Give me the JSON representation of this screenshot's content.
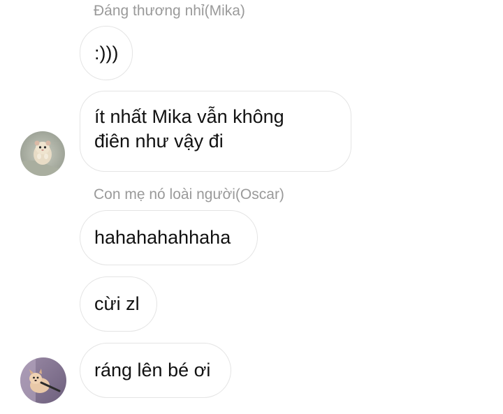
{
  "chat": {
    "groups": [
      {
        "sender": "Đáng thương nhỉ(Mika)",
        "messages": [
          {
            "lines": [
              ":)))"
            ]
          },
          {
            "lines": [
              "ít nhất Mika vẫn không",
              "điên như vậy đi"
            ]
          }
        ],
        "avatar": "hamster-avatar"
      },
      {
        "sender": "Con mẹ nó loài người(Oscar)",
        "messages": [
          {
            "lines": [
              "hahahahahhaha"
            ]
          },
          {
            "lines": [
              "cừi zl"
            ]
          },
          {
            "lines": [
              "ráng lên bé ơi"
            ]
          }
        ],
        "avatar": "puppy-avatar"
      }
    ]
  },
  "colors": {
    "sender_name": "#9a9a9a",
    "bubble_border": "#e4e4e4",
    "message_text": "#111111",
    "background": "#ffffff"
  }
}
